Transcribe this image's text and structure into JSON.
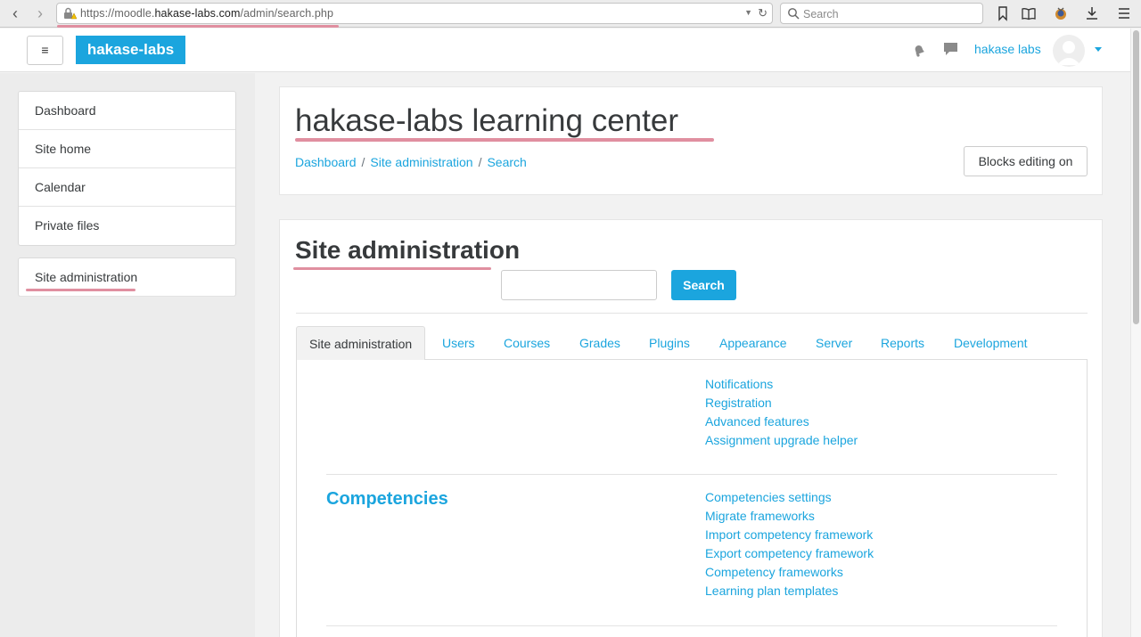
{
  "browser": {
    "url_prefix": "https://moodle.",
    "url_domain": "hakase-labs.com",
    "url_path": "/admin/search.php",
    "search_placeholder": "Search"
  },
  "navbar": {
    "brand": "hakase-labs",
    "menu_icon": "≡",
    "user_name": "hakase labs"
  },
  "drawer": {
    "items": [
      "Dashboard",
      "Site home",
      "Calendar",
      "Private files"
    ],
    "admin_item": "Site administration"
  },
  "header": {
    "title": "hakase-labs learning center",
    "breadcrumb": [
      "Dashboard",
      "Site administration",
      "Search"
    ],
    "blocks_button": "Blocks editing on"
  },
  "main": {
    "title": "Site administration",
    "search_button": "Search",
    "search_value": "",
    "tabs": [
      "Site administration",
      "Users",
      "Courses",
      "Grades",
      "Plugins",
      "Appearance",
      "Server",
      "Reports",
      "Development"
    ],
    "general_links": [
      "Notifications",
      "Registration",
      "Advanced features",
      "Assignment upgrade helper"
    ],
    "sections": [
      {
        "heading": "Competencies",
        "links": [
          "Competencies settings",
          "Migrate frameworks",
          "Import competency framework",
          "Export competency framework",
          "Competency frameworks",
          "Learning plan templates"
        ]
      }
    ]
  },
  "colors": {
    "accent": "#1ba5de",
    "highlight_underline": "#e08fa0"
  }
}
